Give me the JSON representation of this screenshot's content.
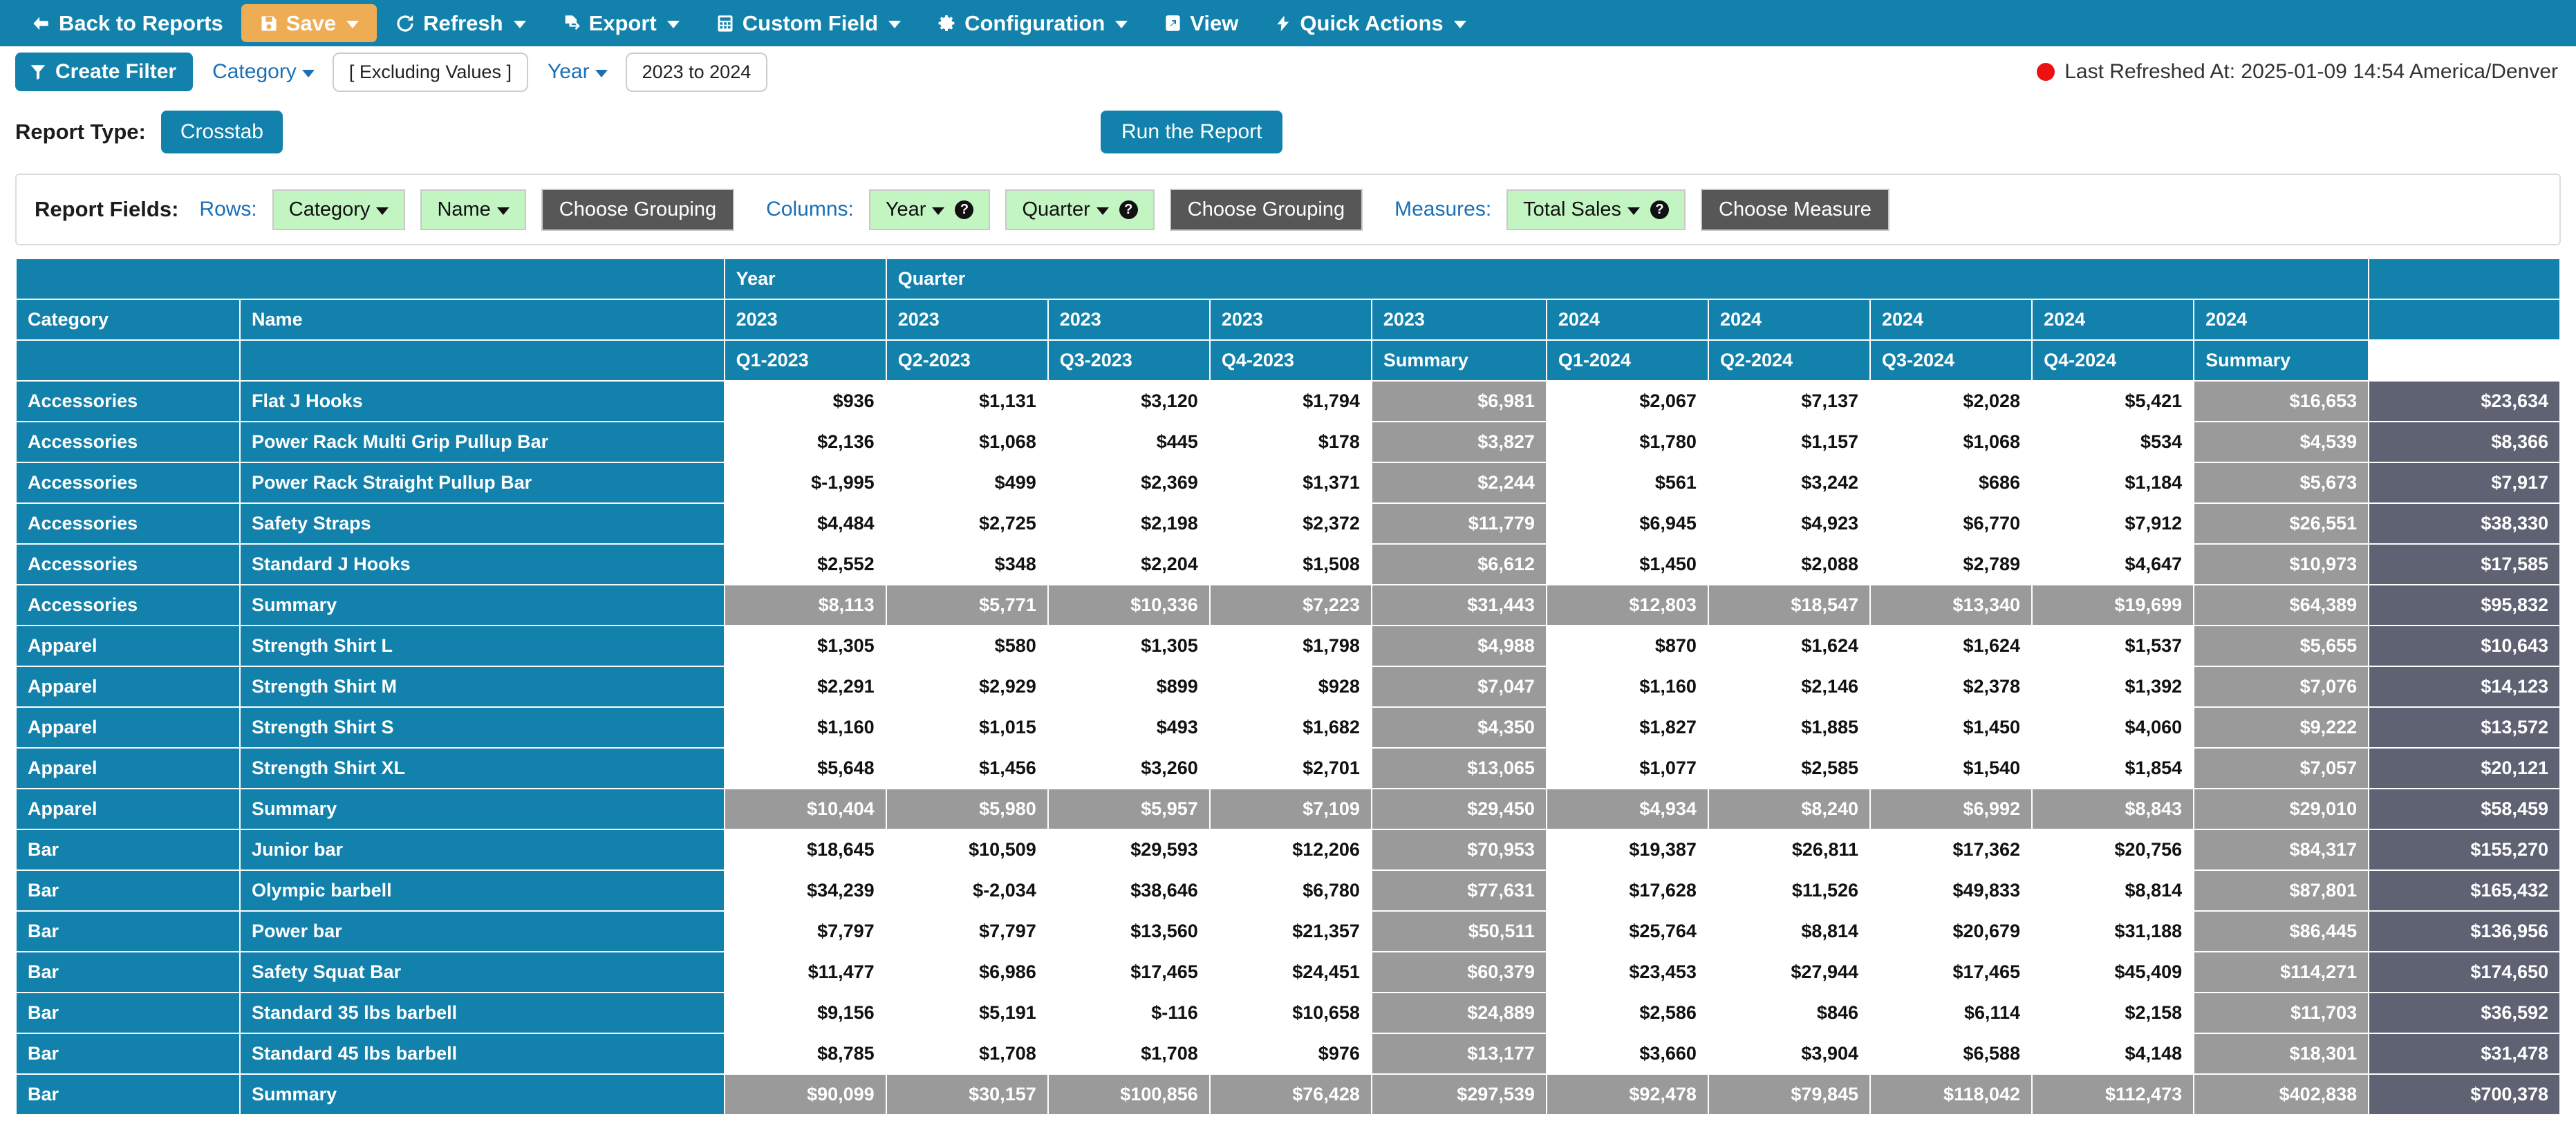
{
  "toolbar": {
    "items": [
      {
        "label": "Back to Reports",
        "icon": "arrow-left-icon",
        "caret": false,
        "active": false
      },
      {
        "label": "Save",
        "icon": "save-disk-icon",
        "caret": true,
        "active": true
      },
      {
        "label": "Refresh",
        "icon": "refresh-icon",
        "caret": true,
        "active": false
      },
      {
        "label": "Export",
        "icon": "export-file-icon",
        "caret": true,
        "active": false
      },
      {
        "label": "Custom Field",
        "icon": "calculator-icon",
        "caret": true,
        "active": false
      },
      {
        "label": "Configuration",
        "icon": "gear-icon",
        "caret": true,
        "active": false
      },
      {
        "label": "View",
        "icon": "expand-view-icon",
        "caret": false,
        "active": false
      },
      {
        "label": "Quick Actions",
        "icon": "lightning-bolt-icon",
        "caret": true,
        "active": false
      }
    ]
  },
  "filterbar": {
    "create_filter_label": "Create Filter",
    "category_label": "Category",
    "excluding_values_label": "[ Excluding Values ]",
    "year_label": "Year",
    "year_range_label": "2023 to 2024",
    "last_refreshed_label": "Last Refreshed At: 2025-01-09 14:54 America/Denver",
    "status_dot_color": "#ee1111"
  },
  "report_type": {
    "label": "Report Type:",
    "value": "Crosstab",
    "run_button_label": "Run the Report"
  },
  "report_fields": {
    "title": "Report Fields:",
    "rows_label": "Rows:",
    "rows_fields": [
      {
        "label": "Category",
        "help": false
      },
      {
        "label": "Name",
        "help": false
      }
    ],
    "rows_grouping_label": "Choose Grouping",
    "columns_label": "Columns:",
    "columns_fields": [
      {
        "label": "Year",
        "help": true
      },
      {
        "label": "Quarter",
        "help": true
      }
    ],
    "columns_grouping_label": "Choose Grouping",
    "measures_label": "Measures:",
    "measures_fields": [
      {
        "label": "Total Sales",
        "help": true
      }
    ],
    "measures_button_label": "Choose Measure"
  },
  "crosstab": {
    "dimension_row_labels": [
      "Year",
      "Quarter"
    ],
    "row_headers": [
      "Category",
      "Name"
    ],
    "year_row": [
      "2023",
      "2023",
      "2023",
      "2023",
      "2023",
      "2024",
      "2024",
      "2024",
      "2024",
      "2024"
    ],
    "quarter_row": [
      "Q1-2023",
      "Q2-2023",
      "Q3-2023",
      "Q4-2023",
      "Summary",
      "Q1-2024",
      "Q2-2024",
      "Q3-2024",
      "Q4-2024",
      "Summary"
    ],
    "column_kinds": [
      "q",
      "q",
      "q",
      "q",
      "sum",
      "q",
      "q",
      "q",
      "q",
      "sum",
      "grand"
    ],
    "rows": [
      {
        "category": "Accessories",
        "name": "Flat J Hooks",
        "summary": false,
        "values": [
          "$936",
          "$1,131",
          "$3,120",
          "$1,794",
          "$6,981",
          "$2,067",
          "$7,137",
          "$2,028",
          "$5,421",
          "$16,653",
          "$23,634"
        ]
      },
      {
        "category": "Accessories",
        "name": "Power Rack Multi Grip Pullup Bar",
        "summary": false,
        "values": [
          "$2,136",
          "$1,068",
          "$445",
          "$178",
          "$3,827",
          "$1,780",
          "$1,157",
          "$1,068",
          "$534",
          "$4,539",
          "$8,366"
        ]
      },
      {
        "category": "Accessories",
        "name": "Power Rack Straight Pullup Bar",
        "summary": false,
        "values": [
          "$-1,995",
          "$499",
          "$2,369",
          "$1,371",
          "$2,244",
          "$561",
          "$3,242",
          "$686",
          "$1,184",
          "$5,673",
          "$7,917"
        ]
      },
      {
        "category": "Accessories",
        "name": "Safety Straps",
        "summary": false,
        "values": [
          "$4,484",
          "$2,725",
          "$2,198",
          "$2,372",
          "$11,779",
          "$6,945",
          "$4,923",
          "$6,770",
          "$7,912",
          "$26,551",
          "$38,330"
        ]
      },
      {
        "category": "Accessories",
        "name": "Standard J Hooks",
        "summary": false,
        "values": [
          "$2,552",
          "$348",
          "$2,204",
          "$1,508",
          "$6,612",
          "$1,450",
          "$2,088",
          "$2,789",
          "$4,647",
          "$10,973",
          "$17,585"
        ]
      },
      {
        "category": "Accessories",
        "name": "Summary",
        "summary": true,
        "values": [
          "$8,113",
          "$5,771",
          "$10,336",
          "$7,223",
          "$31,443",
          "$12,803",
          "$18,547",
          "$13,340",
          "$19,699",
          "$64,389",
          "$95,832"
        ]
      },
      {
        "category": "Apparel",
        "name": "Strength Shirt L",
        "summary": false,
        "values": [
          "$1,305",
          "$580",
          "$1,305",
          "$1,798",
          "$4,988",
          "$870",
          "$1,624",
          "$1,624",
          "$1,537",
          "$5,655",
          "$10,643"
        ]
      },
      {
        "category": "Apparel",
        "name": "Strength Shirt M",
        "summary": false,
        "values": [
          "$2,291",
          "$2,929",
          "$899",
          "$928",
          "$7,047",
          "$1,160",
          "$2,146",
          "$2,378",
          "$1,392",
          "$7,076",
          "$14,123"
        ]
      },
      {
        "category": "Apparel",
        "name": "Strength Shirt S",
        "summary": false,
        "values": [
          "$1,160",
          "$1,015",
          "$493",
          "$1,682",
          "$4,350",
          "$1,827",
          "$1,885",
          "$1,450",
          "$4,060",
          "$9,222",
          "$13,572"
        ]
      },
      {
        "category": "Apparel",
        "name": "Strength Shirt XL",
        "summary": false,
        "values": [
          "$5,648",
          "$1,456",
          "$3,260",
          "$2,701",
          "$13,065",
          "$1,077",
          "$2,585",
          "$1,540",
          "$1,854",
          "$7,057",
          "$20,121"
        ]
      },
      {
        "category": "Apparel",
        "name": "Summary",
        "summary": true,
        "values": [
          "$10,404",
          "$5,980",
          "$5,957",
          "$7,109",
          "$29,450",
          "$4,934",
          "$8,240",
          "$6,992",
          "$8,843",
          "$29,010",
          "$58,459"
        ]
      },
      {
        "category": "Bar",
        "name": "Junior bar",
        "summary": false,
        "values": [
          "$18,645",
          "$10,509",
          "$29,593",
          "$12,206",
          "$70,953",
          "$19,387",
          "$26,811",
          "$17,362",
          "$20,756",
          "$84,317",
          "$155,270"
        ]
      },
      {
        "category": "Bar",
        "name": "Olympic barbell",
        "summary": false,
        "values": [
          "$34,239",
          "$-2,034",
          "$38,646",
          "$6,780",
          "$77,631",
          "$17,628",
          "$11,526",
          "$49,833",
          "$8,814",
          "$87,801",
          "$165,432"
        ]
      },
      {
        "category": "Bar",
        "name": "Power bar",
        "summary": false,
        "values": [
          "$7,797",
          "$7,797",
          "$13,560",
          "$21,357",
          "$50,511",
          "$25,764",
          "$8,814",
          "$20,679",
          "$31,188",
          "$86,445",
          "$136,956"
        ]
      },
      {
        "category": "Bar",
        "name": "Safety Squat Bar",
        "summary": false,
        "values": [
          "$11,477",
          "$6,986",
          "$17,465",
          "$24,451",
          "$60,379",
          "$23,453",
          "$27,944",
          "$17,465",
          "$45,409",
          "$114,271",
          "$174,650"
        ]
      },
      {
        "category": "Bar",
        "name": "Standard 35 lbs barbell",
        "summary": false,
        "values": [
          "$9,156",
          "$5,191",
          "$-116",
          "$10,658",
          "$24,889",
          "$2,586",
          "$846",
          "$6,114",
          "$2,158",
          "$11,703",
          "$36,592"
        ]
      },
      {
        "category": "Bar",
        "name": "Standard 45 lbs barbell",
        "summary": false,
        "values": [
          "$8,785",
          "$1,708",
          "$1,708",
          "$976",
          "$13,177",
          "$3,660",
          "$3,904",
          "$6,588",
          "$4,148",
          "$18,301",
          "$31,478"
        ]
      },
      {
        "category": "Bar",
        "name": "Summary",
        "summary": true,
        "values": [
          "$90,099",
          "$30,157",
          "$100,856",
          "$76,428",
          "$297,539",
          "$92,478",
          "$79,845",
          "$118,042",
          "$112,473",
          "$402,838",
          "$700,378"
        ]
      }
    ]
  },
  "colors": {
    "brand_blue": "#1281ab",
    "save_orange": "#eeac55",
    "field_green": "#c3f5c3",
    "grouping_gray": "#575757",
    "summary_gray": "#9a9a9a",
    "grand_total": "#5e6273",
    "link_blue": "#1a6fb5"
  }
}
